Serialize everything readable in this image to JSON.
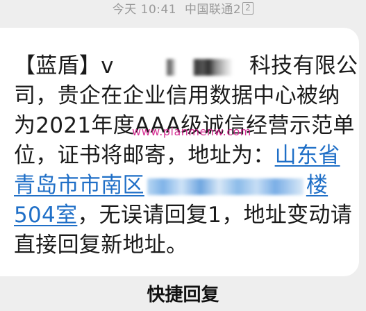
{
  "status": {
    "time_label": "今天 10:41",
    "carrier": "中国联通2",
    "sim_badge": "2"
  },
  "message": {
    "prefix": "【蓝盾】",
    "fragment_v": "v",
    "company_suffix": "科技有限公司，贵企在企业信用数据中心被纳为2021年度AAA级诚信经营示范单位，证书将邮寄，地址为：",
    "address_start": "山东省青岛市市南区",
    "address_end_char": "楼",
    "address_room": "504室",
    "closing": "，无误请回复1，地址变动请直接回复新地址。"
  },
  "watermark": "www.pianmenw.com",
  "quick_reply_label": "快捷回复",
  "colors": {
    "background": "#eeeeee",
    "bubble": "#ffffff",
    "link": "#1f6fc7",
    "watermark": "#d21c8a"
  }
}
